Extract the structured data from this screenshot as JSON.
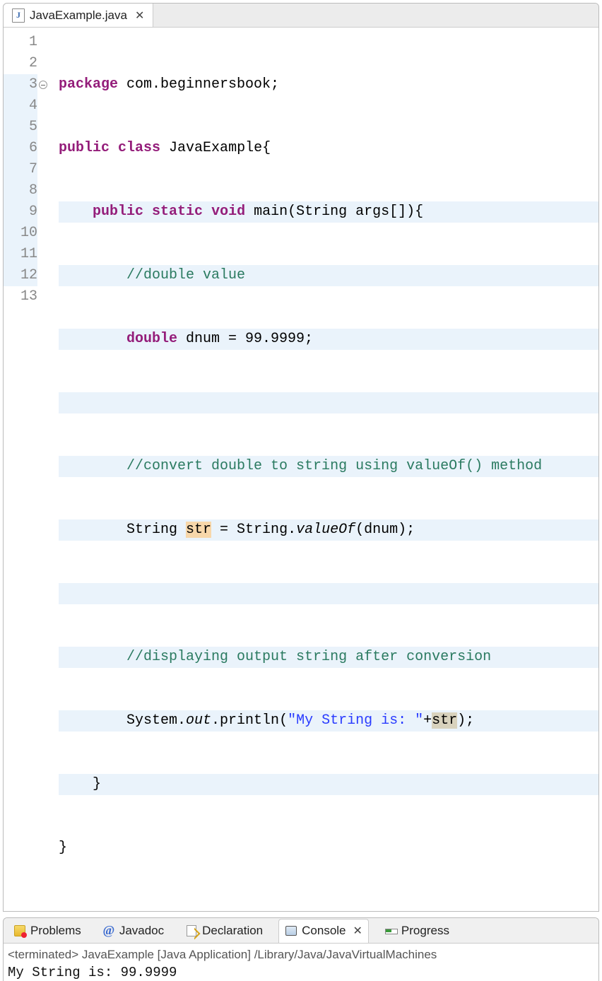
{
  "editor": {
    "tab": {
      "filename": "JavaExample.java"
    },
    "code": {
      "l1": {
        "kw1": "package",
        "rest": " com.beginnersbook;"
      },
      "l2": {
        "kw1": "public",
        "kw2": "class",
        "rest": " JavaExample{"
      },
      "l3": {
        "kw1": "public",
        "kw2": "static",
        "kw3": "void",
        "rest": " main(String args[]){"
      },
      "l4": {
        "cm": "//double value"
      },
      "l5": {
        "kw1": "double",
        "rest": " dnum = 99.9999;"
      },
      "l7": {
        "cm": "//convert double to string using valueOf() method"
      },
      "l8": {
        "p1": "String ",
        "mk": "str",
        "p2": " = String.",
        "it": "valueOf",
        "p3": "(dnum);"
      },
      "l10": {
        "cm": "//displaying output string after conversion"
      },
      "l11": {
        "p1": "System.",
        "it": "out",
        "p2": ".println(",
        "str": "\"My String is: \"",
        "p3": "+",
        "mk": "str",
        "p4": ");"
      },
      "l12": "    }",
      "l13": "}"
    },
    "line_numbers": [
      "1",
      "2",
      "3",
      "4",
      "5",
      "6",
      "7",
      "8",
      "9",
      "10",
      "11",
      "12",
      "13"
    ]
  },
  "bottom": {
    "tabs": {
      "problems": "Problems",
      "javadoc": "Javadoc",
      "declaration": "Declaration",
      "console": "Console",
      "progress": "Progress"
    },
    "console": {
      "status": "<terminated> JavaExample [Java Application] /Library/Java/JavaVirtualMachines",
      "output": "My String is: 99.9999"
    }
  }
}
